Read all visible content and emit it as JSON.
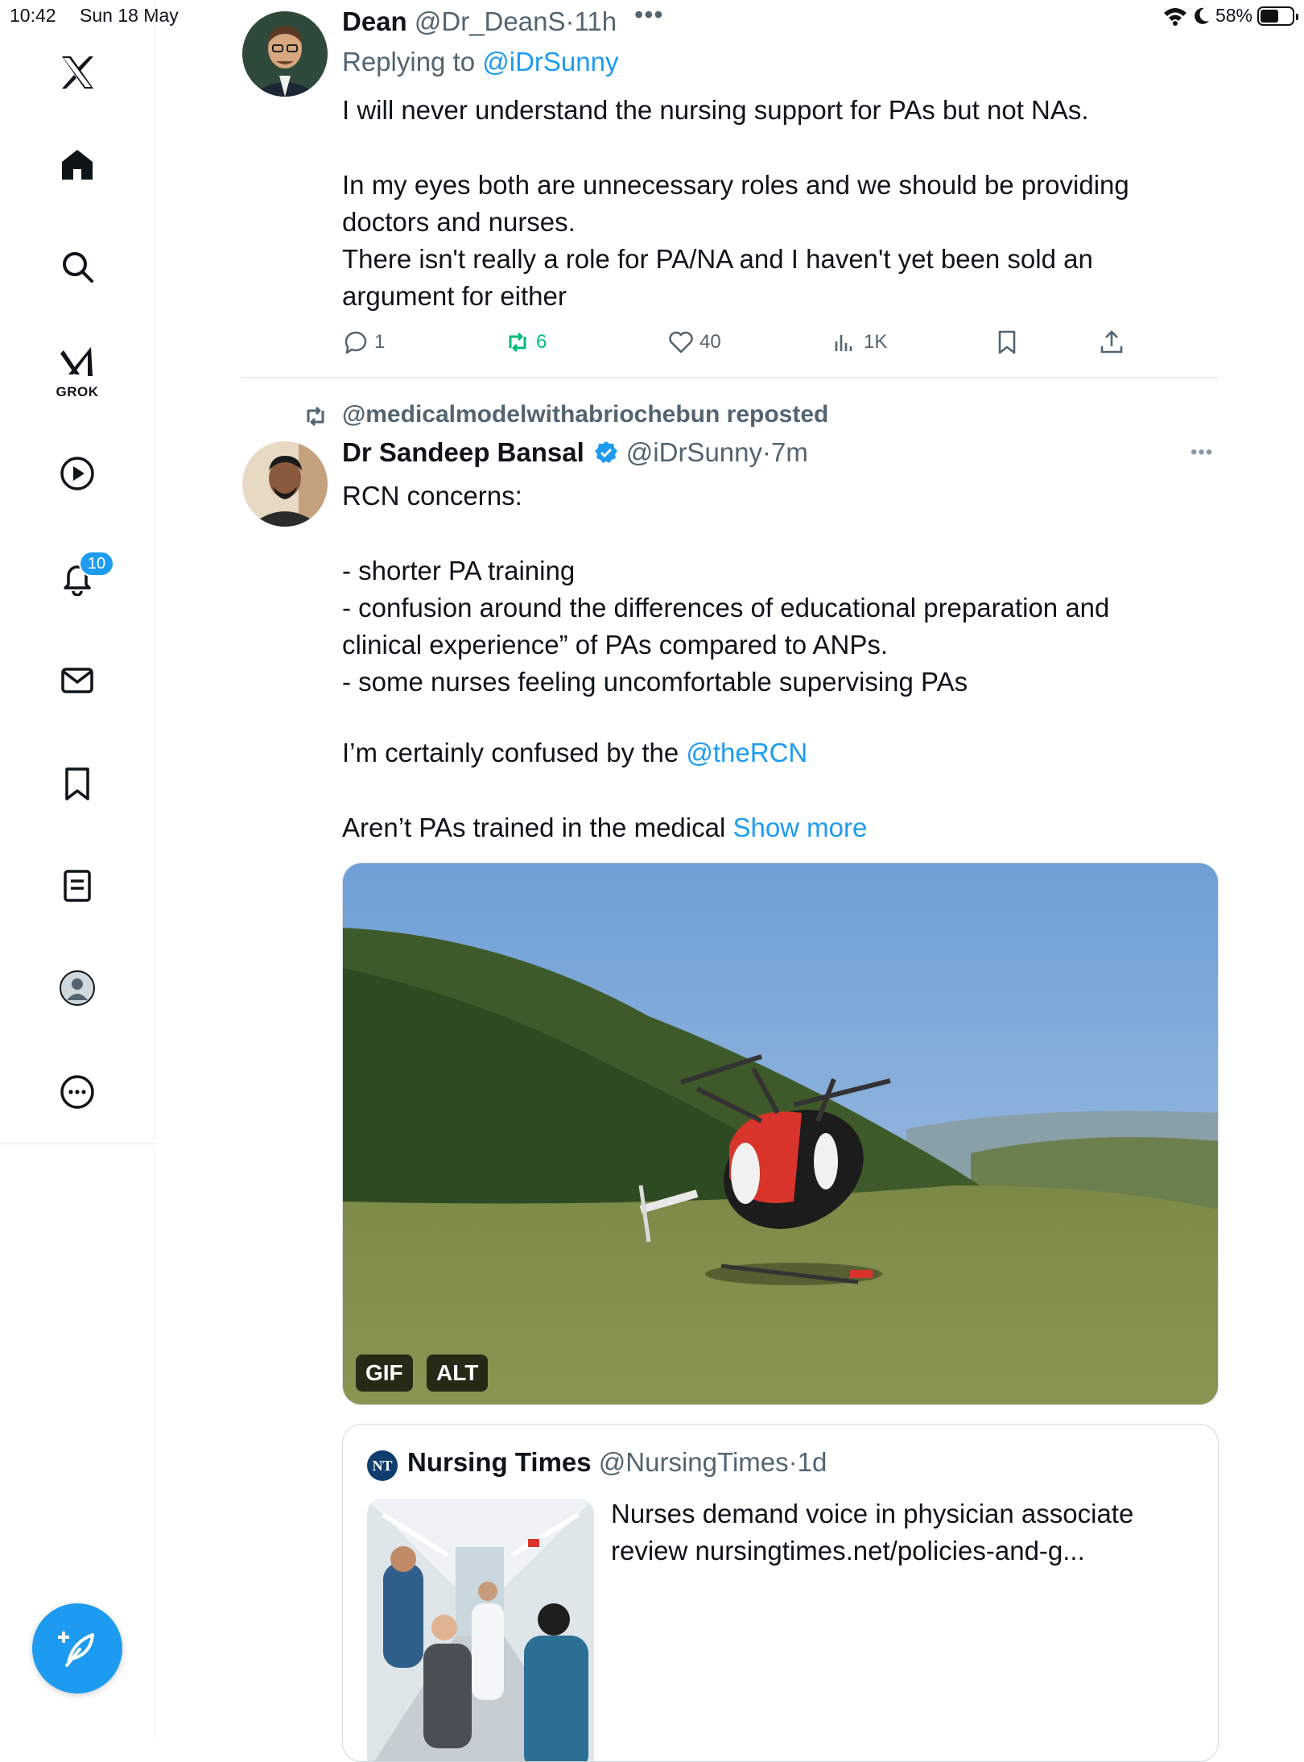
{
  "status_bar": {
    "time": "10:42",
    "date": "Sun 18 May",
    "battery": "58%",
    "battery_level": 0.58,
    "icons": [
      "wifi-icon",
      "moon-icon",
      "battery-icon"
    ]
  },
  "sidebar": {
    "items": [
      {
        "name": "x-logo",
        "icon": "x-logo-icon"
      },
      {
        "name": "home",
        "icon": "home-icon"
      },
      {
        "name": "search",
        "icon": "search-icon"
      },
      {
        "name": "grok",
        "icon": "grok-icon",
        "label": "GROK"
      },
      {
        "name": "videos",
        "icon": "play-icon"
      },
      {
        "name": "notifications",
        "icon": "bell-icon",
        "badge": "10"
      },
      {
        "name": "messages",
        "icon": "mail-icon"
      },
      {
        "name": "bookmarks",
        "icon": "bookmark-icon"
      },
      {
        "name": "articles",
        "icon": "document-icon"
      },
      {
        "name": "profile",
        "icon": "profile-icon"
      },
      {
        "name": "more",
        "icon": "more-circle-icon"
      }
    ],
    "compose_icon": "compose-icon"
  },
  "reply_tweet": {
    "name": "Dean",
    "handle": "@Dr_DeanS",
    "time": "11h",
    "replying_prefix": "Replying to ",
    "replying_handle": "@iDrSunny",
    "text": "I will never understand the nursing support for PAs but not NAs.\n\nIn my eyes both are unnecessary roles and we should be providing doctors and nurses.\nThere isn't really a role for PA/NA and I haven't yet been sold an argument for either",
    "actions": {
      "replies": "1",
      "reposts": "6",
      "likes": "40",
      "views": "1K"
    }
  },
  "main_tweet": {
    "repost_label": "@medicalmodelwithabriochebun reposted",
    "name": "Dr Sandeep Bansal",
    "handle": "@iDrSunny",
    "time": "7m",
    "text_block": "RCN concerns:\n\n- shorter PA training\n- confusion around the differences of educational preparation and clinical experience” of PAs compared to ANPs.\n- some nurses feeling uncomfortable supervising PAs",
    "mention_prefix": "I’m certainly confused by the ",
    "mention": "@theRCN",
    "truncated_text": "Aren’t PAs trained in the medical ",
    "show_more": "Show more",
    "media_badges": {
      "gif": "GIF",
      "alt": "ALT"
    },
    "quote": {
      "logo": "NT",
      "name": "Nursing Times",
      "handle": "@NursingTimes",
      "time": "1d",
      "text": "Nurses demand voice in physician associate review nursingtimes.net/policies-and-g..."
    }
  },
  "separator_dot": "·"
}
